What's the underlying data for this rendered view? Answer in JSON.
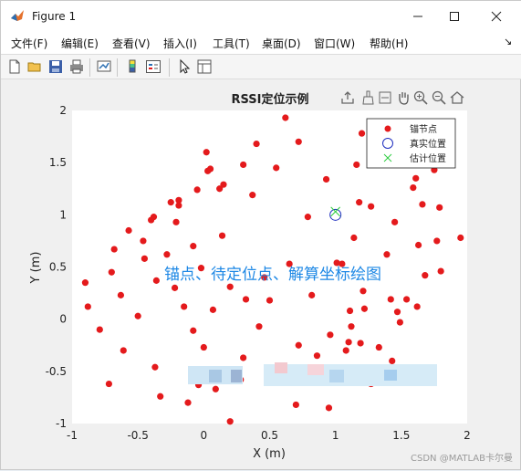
{
  "window": {
    "title": "Figure 1",
    "controls": {
      "minimize": "—",
      "maximize": "☐",
      "close": "✕"
    }
  },
  "menubar": {
    "items": [
      "文件(F)",
      "编辑(E)",
      "查看(V)",
      "插入(I)",
      "工具(T)",
      "桌面(D)",
      "窗口(W)",
      "帮助(H)"
    ],
    "overflow": "↘"
  },
  "toolbar": {
    "icons": [
      "new-figure-icon",
      "open-file-icon",
      "save-icon",
      "print-icon",
      "link-plot-icon",
      "colorbar-icon",
      "legend-icon",
      "pointer-icon",
      "property-inspector-icon"
    ]
  },
  "axes_toolbar": {
    "icons": [
      "export-icon",
      "brush-icon",
      "datatip-icon",
      "pan-icon",
      "zoom-in-icon",
      "zoom-out-icon",
      "home-icon"
    ]
  },
  "watermark": "CSDN @MATLAB卡尔曼",
  "chart_data": {
    "type": "scatter",
    "title": "RSSI定位示例",
    "xlabel": "X (m)",
    "ylabel": "Y (m)",
    "xlim": [
      -1,
      2
    ],
    "ylim": [
      -1,
      2
    ],
    "xticks": [
      "-1",
      "-0.5",
      "0",
      "0.5",
      "1",
      "1.5",
      "2"
    ],
    "yticks": [
      "-1",
      "-0.5",
      "0",
      "0.5",
      "1",
      "1.5",
      "2"
    ],
    "grid": false,
    "legend_position": "top-right",
    "annotation": "锚点、待定位点、解算坐标绘图",
    "colors": {
      "anchor": "#e41a1c",
      "true": "#1f2fbf",
      "estimate": "#2ecc40",
      "annotation": "#1e88e5"
    },
    "series": [
      {
        "name": "锚节点",
        "marker": "filled-circle",
        "points": [
          [
            -0.9,
            0.35
          ],
          [
            -0.88,
            0.12
          ],
          [
            -0.79,
            -0.1
          ],
          [
            -0.72,
            -0.62
          ],
          [
            -0.7,
            0.45
          ],
          [
            -0.68,
            0.67
          ],
          [
            -0.63,
            0.23
          ],
          [
            -0.61,
            -0.3
          ],
          [
            -0.57,
            0.85
          ],
          [
            -0.5,
            0.03
          ],
          [
            -0.46,
            0.75
          ],
          [
            -0.45,
            0.58
          ],
          [
            -0.4,
            0.95
          ],
          [
            -0.38,
            0.98
          ],
          [
            -0.37,
            -0.46
          ],
          [
            -0.36,
            0.37
          ],
          [
            -0.33,
            -0.74
          ],
          [
            -0.28,
            0.62
          ],
          [
            -0.25,
            1.12
          ],
          [
            -0.22,
            0.3
          ],
          [
            -0.21,
            0.93
          ],
          [
            -0.19,
            1.09
          ],
          [
            -0.19,
            1.14
          ],
          [
            -0.15,
            0.12
          ],
          [
            -0.12,
            -0.8
          ],
          [
            -0.08,
            0.7
          ],
          [
            -0.08,
            -0.11
          ],
          [
            -0.07,
            -0.55
          ],
          [
            -0.05,
            1.24
          ],
          [
            -0.04,
            -0.63
          ],
          [
            -0.02,
            0.49
          ],
          [
            0.0,
            -0.27
          ],
          [
            0.02,
            1.6
          ],
          [
            0.03,
            1.42
          ],
          [
            0.05,
            1.44
          ],
          [
            0.07,
            0.09
          ],
          [
            0.09,
            -0.67
          ],
          [
            0.12,
            1.25
          ],
          [
            0.14,
            0.8
          ],
          [
            0.15,
            1.29
          ],
          [
            0.2,
            0.31
          ],
          [
            0.2,
            -0.98
          ],
          [
            0.28,
            -0.58
          ],
          [
            0.3,
            1.48
          ],
          [
            0.3,
            -0.37
          ],
          [
            0.32,
            0.19
          ],
          [
            0.37,
            1.19
          ],
          [
            0.4,
            1.68
          ],
          [
            0.42,
            -0.07
          ],
          [
            0.46,
            0.4
          ],
          [
            0.5,
            0.18
          ],
          [
            0.55,
            1.45
          ],
          [
            0.62,
            -0.53
          ],
          [
            0.62,
            1.93
          ],
          [
            0.65,
            0.53
          ],
          [
            0.7,
            -0.82
          ],
          [
            0.72,
            -0.25
          ],
          [
            0.72,
            1.7
          ],
          [
            0.79,
            0.98
          ],
          [
            0.82,
            0.23
          ],
          [
            0.86,
            -0.35
          ],
          [
            0.93,
            1.34
          ],
          [
            0.95,
            -0.85
          ],
          [
            0.96,
            -0.15
          ],
          [
            1.01,
            0.54
          ],
          [
            1.05,
            0.53
          ],
          [
            1.08,
            -0.3
          ],
          [
            1.1,
            -0.22
          ],
          [
            1.11,
            0.08
          ],
          [
            1.12,
            -0.07
          ],
          [
            1.14,
            0.78
          ],
          [
            1.16,
            1.48
          ],
          [
            1.18,
            1.12
          ],
          [
            1.19,
            -0.23
          ],
          [
            1.2,
            1.78
          ],
          [
            1.21,
            0.27
          ],
          [
            1.22,
            0.1
          ],
          [
            1.27,
            1.08
          ],
          [
            1.33,
            -0.27
          ],
          [
            1.39,
            0.62
          ],
          [
            1.43,
            -0.4
          ],
          [
            1.45,
            0.93
          ],
          [
            1.47,
            0.07
          ],
          [
            1.49,
            -0.03
          ],
          [
            1.54,
            0.19
          ],
          [
            1.59,
            1.26
          ],
          [
            1.61,
            1.35
          ],
          [
            1.62,
            0.12
          ],
          [
            1.63,
            0.71
          ],
          [
            1.66,
            1.1
          ],
          [
            1.68,
            0.42
          ],
          [
            1.73,
            1.82
          ],
          [
            1.75,
            1.43
          ],
          [
            1.77,
            0.75
          ],
          [
            1.79,
            1.07
          ],
          [
            1.8,
            0.46
          ],
          [
            1.86,
            1.63
          ],
          [
            1.95,
            0.78
          ],
          [
            1.42,
            0.19
          ],
          [
            1.27,
            -0.62
          ]
        ]
      },
      {
        "name": "真实位置",
        "marker": "open-circle",
        "points": [
          [
            1.0,
            1.0
          ]
        ]
      },
      {
        "name": "估计位置",
        "marker": "x",
        "points": [
          [
            1.0,
            1.03
          ]
        ]
      }
    ]
  }
}
